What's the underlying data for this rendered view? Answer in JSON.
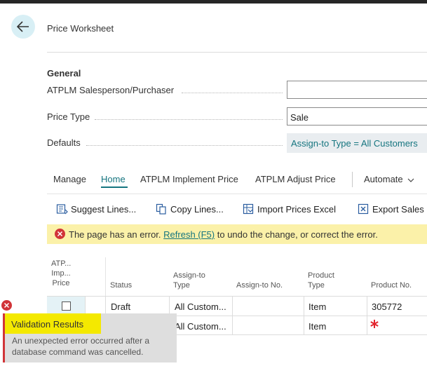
{
  "header": {
    "title": "Price Worksheet"
  },
  "general": {
    "section_title": "General",
    "salesperson_label": "ATPLM Salesperson/Purchaser",
    "salesperson_value": "",
    "price_type_label": "Price Type",
    "price_type_value": "Sale",
    "defaults_label": "Defaults",
    "defaults_value": "Assign-to Type = All Customers"
  },
  "tabs": [
    "Manage",
    "Home",
    "ATPLM Implement Price",
    "ATPLM Adjust Price",
    "Automate"
  ],
  "active_tab": "Home",
  "actions": [
    "Suggest Lines...",
    "Copy Lines...",
    "Import Prices Excel",
    "Export Sales"
  ],
  "error_bar": {
    "text_before": "The page has an error.",
    "link": "Refresh (F5)",
    "text_after": "to undo the change, or correct the error."
  },
  "grid": {
    "headers": {
      "implement": [
        "ATP...",
        "Imp...",
        "Price"
      ],
      "status": "Status",
      "assign_to_type": [
        "Assign-to",
        "Type"
      ],
      "assign_to_no": "Assign-to No.",
      "product_type": [
        "Product",
        "Type"
      ],
      "product_no": "Product No."
    },
    "rows": [
      {
        "implement_checked": false,
        "status": "Draft",
        "assign_to_type": "All Custom...",
        "assign_to_no": "",
        "product_type": "Item",
        "product_no": "305772"
      },
      {
        "status": "",
        "assign_to_type": "All Custom...",
        "assign_to_no": "",
        "product_type": "Item",
        "product_no": ""
      }
    ]
  },
  "popup": {
    "title": "Validation Results",
    "message": "An unexpected error occurred after a database command was cancelled."
  },
  "colors": {
    "accent": "#15757f",
    "error": "#d13438",
    "warning_bg": "#fbf1a9",
    "popup_title_bg": "#f4e900"
  },
  "icons": {
    "back": "arrow-left-icon",
    "error": "error-circle-icon",
    "required": "asterisk-icon",
    "chevron": "chevron-down-icon"
  }
}
